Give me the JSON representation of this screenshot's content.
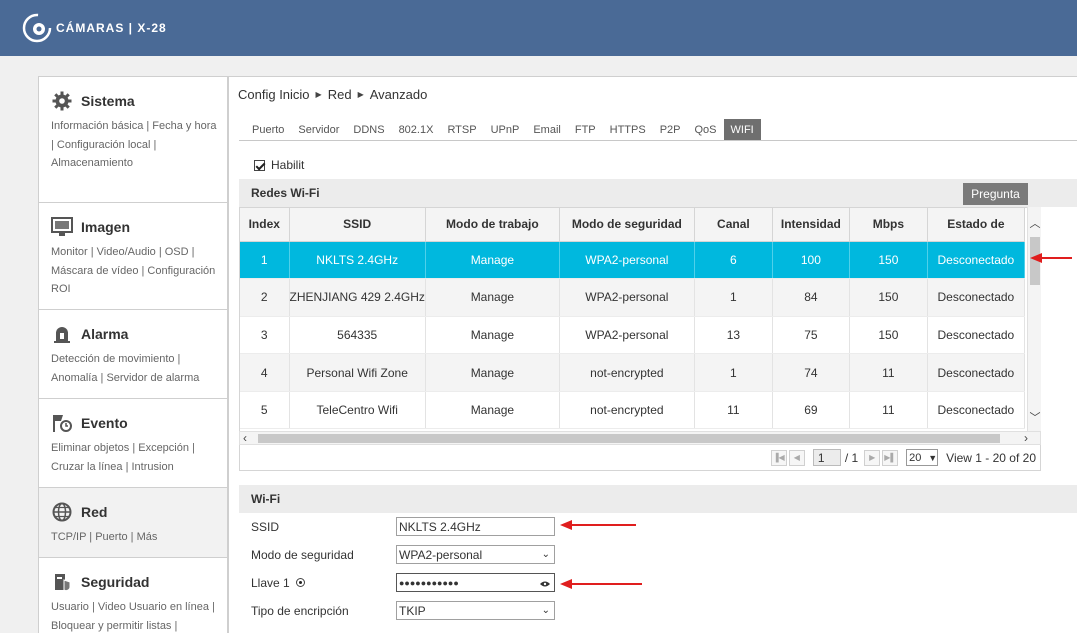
{
  "brand": {
    "name": "CÁMARAS | X-28"
  },
  "sidebar": [
    {
      "title": "Sistema",
      "icon": "gear-icon",
      "links": "Información básica | Fecha y hora | Configuración local | Almacenamiento"
    },
    {
      "title": "Imagen",
      "icon": "monitor-icon",
      "links": "Monitor | Video/Audio | OSD | Máscara de vídeo | Configuración ROI"
    },
    {
      "title": "Alarma",
      "icon": "bell-icon",
      "links": "Detección de movimiento | Anomalía | Servidor de alarma"
    },
    {
      "title": "Evento",
      "icon": "event-icon",
      "links": "Eliminar objetos | Excepción | Cruzar la línea | Intrusion"
    },
    {
      "title": "Red",
      "icon": "globe-icon",
      "links": "TCP/IP | Puerto | Más"
    },
    {
      "title": "Seguridad",
      "icon": "security-icon",
      "links": "Usuario | Video Usuario en línea | Bloquear y permitir listas |"
    }
  ],
  "breadcrumb": [
    "Config Inicio",
    "Red",
    "Avanzado"
  ],
  "tabs": [
    "Puerto",
    "Servidor",
    "DDNS",
    "802.1X",
    "RTSP",
    "UPnP",
    "Email",
    "FTP",
    "HTTPS",
    "P2P",
    "QoS",
    "WIFI"
  ],
  "selected_tab": "WIFI",
  "enable_label": "Habilit",
  "networks": {
    "title": "Redes Wi-Fi",
    "ask_button": "Pregunta",
    "columns": [
      "Index",
      "SSID",
      "Modo de trabajo",
      "Modo de seguridad",
      "Canal",
      "Intensidad",
      "Mbps",
      "Estado de"
    ],
    "rows": [
      [
        "1",
        "NKLTS 2.4GHz",
        "Manage",
        "WPA2-personal",
        "6",
        "100",
        "150",
        "Desconectado"
      ],
      [
        "2",
        "ZHENJIANG 429 2.4GHz",
        "Manage",
        "WPA2-personal",
        "1",
        "84",
        "150",
        "Desconectado"
      ],
      [
        "3",
        "564335",
        "Manage",
        "WPA2-personal",
        "13",
        "75",
        "150",
        "Desconectado"
      ],
      [
        "4",
        "Personal Wifi Zone",
        "Manage",
        "not-encrypted",
        "1",
        "74",
        "11",
        "Desconectado"
      ],
      [
        "5",
        "TeleCentro Wifi",
        "Manage",
        "not-encrypted",
        "11",
        "69",
        "11",
        "Desconectado"
      ]
    ],
    "selected_row": 0
  },
  "pager": {
    "page": "1",
    "total": "/ 1",
    "per_page": "20",
    "summary": "View 1 - 20 of 20"
  },
  "wifi_form": {
    "title": "Wi-Fi",
    "ssid_label": "SSID",
    "ssid_value": "NKLTS 2.4GHz",
    "security_label": "Modo de seguridad",
    "security_value": "WPA2-personal",
    "key_label": "Llave 1",
    "key_value": "●●●●●●●●●●●",
    "encryption_label": "Tipo de encripción",
    "encryption_value": "TKIP"
  },
  "colors": {
    "header": "#4a6a96",
    "selected_row": "#00b8de",
    "annotation_arrow": "#e01e1e"
  }
}
